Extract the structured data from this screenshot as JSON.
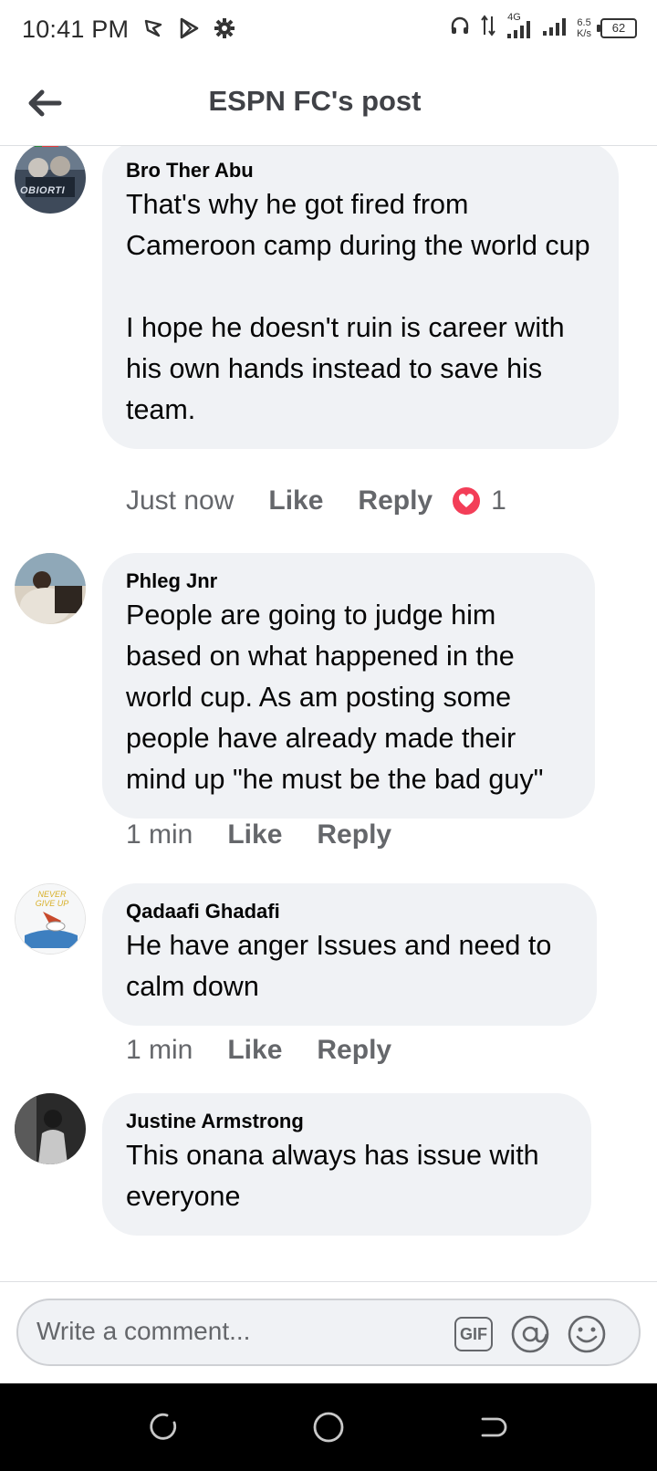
{
  "status_bar": {
    "time": "10:41 PM",
    "network": "4G",
    "speed_value": "6.5",
    "speed_unit": "K/s",
    "battery": "62"
  },
  "header": {
    "title": "ESPN FC's post"
  },
  "comments": [
    {
      "author": "Bro Ther Abu",
      "text": "That's why he got fired from Cameroon camp during the world cup\n\nI hope he doesn't ruin is career with his own hands instead to save his team.",
      "time": "Just now",
      "like": "Like",
      "reply": "Reply",
      "reaction_count": "1",
      "reaction_icon": "heart-icon",
      "avatar_text": "OBIORTI"
    },
    {
      "author": "Phleg Jnr",
      "text": "People are going to judge him based on what happened in the world cup. As am posting some people have already made their mind up \"he must be the bad guy\"",
      "time": "1 min",
      "like": "Like",
      "reply": "Reply"
    },
    {
      "author": "Qadaafi Ghadafi",
      "text": "He have anger Issues and need to calm down",
      "time": "1 min",
      "like": "Like",
      "reply": "Reply",
      "avatar_text": "NEVER GIVE UP"
    },
    {
      "author": "Justine Armstrong",
      "text": "This onana always has issue with everyone"
    }
  ],
  "composer": {
    "placeholder": "Write a comment...",
    "gif_label": "GIF"
  },
  "colors": {
    "bubble": "#f0f2f5",
    "meta_text": "#65676b",
    "heart": "#f33e58"
  }
}
